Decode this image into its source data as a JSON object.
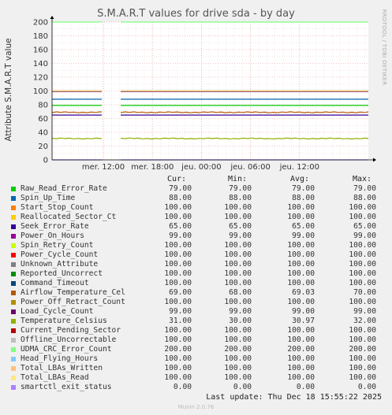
{
  "chart_data": {
    "type": "line",
    "title": "S.M.A.R.T values for drive sda - by day",
    "ylabel": "Attribute S.M.A.R.T value",
    "ylim": [
      0,
      200
    ],
    "yticks": [
      0,
      20,
      40,
      60,
      80,
      100,
      120,
      140,
      160,
      180,
      200
    ],
    "xticks": [
      "mer. 12:00",
      "mer. 18:00",
      "jeu. 00:00",
      "jeu. 06:00",
      "jeu. 12:00"
    ],
    "gap": "short gap in data shortly before mer. 12:00",
    "columns": [
      "Cur:",
      "Min:",
      "Avg:",
      "Max:"
    ],
    "series": [
      {
        "name": "Raw_Read_Error_Rate",
        "color": "#00cc00",
        "cur": "79.00",
        "min": "79.00",
        "avg": "79.00",
        "max": "79.00",
        "value": 79
      },
      {
        "name": "Spin_Up_Time",
        "color": "#0066b3",
        "cur": "88.00",
        "min": "88.00",
        "avg": "88.00",
        "max": "88.00",
        "value": 88
      },
      {
        "name": "Start_Stop_Count",
        "color": "#ff8000",
        "cur": "100.00",
        "min": "100.00",
        "avg": "100.00",
        "max": "100.00",
        "value": 100
      },
      {
        "name": "Reallocated_Sector_Ct",
        "color": "#ffcc00",
        "cur": "100.00",
        "min": "100.00",
        "avg": "100.00",
        "max": "100.00",
        "value": 100
      },
      {
        "name": "Seek_Error_Rate",
        "color": "#330099",
        "cur": "65.00",
        "min": "65.00",
        "avg": "65.00",
        "max": "65.00",
        "value": 65
      },
      {
        "name": "Power_On_Hours",
        "color": "#990099",
        "cur": "99.00",
        "min": "99.00",
        "avg": "99.00",
        "max": "99.00",
        "value": 99
      },
      {
        "name": "Spin_Retry_Count",
        "color": "#ccff00",
        "cur": "100.00",
        "min": "100.00",
        "avg": "100.00",
        "max": "100.00",
        "value": 100
      },
      {
        "name": "Power_Cycle_Count",
        "color": "#ff0000",
        "cur": "100.00",
        "min": "100.00",
        "avg": "100.00",
        "max": "100.00",
        "value": 100
      },
      {
        "name": "Unknown_Attribute",
        "color": "#808080",
        "cur": "100.00",
        "min": "100.00",
        "avg": "100.00",
        "max": "100.00",
        "value": 100
      },
      {
        "name": "Reported_Uncorrect",
        "color": "#008f00",
        "cur": "100.00",
        "min": "100.00",
        "avg": "100.00",
        "max": "100.00",
        "value": 100
      },
      {
        "name": "Command_Timeout",
        "color": "#00487d",
        "cur": "100.00",
        "min": "100.00",
        "avg": "100.00",
        "max": "100.00",
        "value": 100
      },
      {
        "name": "Airflow_Temperature_Cel",
        "color": "#b35a00",
        "cur": "69.00",
        "min": "68.00",
        "avg": "69.03",
        "max": "70.00",
        "value": 69,
        "wobble": true
      },
      {
        "name": "Power_Off_Retract_Count",
        "color": "#b38f00",
        "cur": "100.00",
        "min": "100.00",
        "avg": "100.00",
        "max": "100.00",
        "value": 100
      },
      {
        "name": "Load_Cycle_Count",
        "color": "#6b006b",
        "cur": "99.00",
        "min": "99.00",
        "avg": "99.00",
        "max": "99.00",
        "value": 99
      },
      {
        "name": "Temperature_Celsius",
        "color": "#8fb300",
        "cur": "31.00",
        "min": "30.00",
        "avg": "30.97",
        "max": "32.00",
        "value": 31,
        "wobble": true
      },
      {
        "name": "Current_Pending_Sector",
        "color": "#b30000",
        "cur": "100.00",
        "min": "100.00",
        "avg": "100.00",
        "max": "100.00",
        "value": 100
      },
      {
        "name": "Offline_Uncorrectable",
        "color": "#bebebe",
        "cur": "100.00",
        "min": "100.00",
        "avg": "100.00",
        "max": "100.00",
        "value": 100
      },
      {
        "name": "UDMA_CRC_Error_Count",
        "color": "#80ff80",
        "cur": "200.00",
        "min": "200.00",
        "avg": "200.00",
        "max": "200.00",
        "value": 200
      },
      {
        "name": "Head_Flying_Hours",
        "color": "#80c9ff",
        "cur": "100.00",
        "min": "100.00",
        "avg": "100.00",
        "max": "100.00",
        "value": 100
      },
      {
        "name": "Total_LBAs_Written",
        "color": "#ffc080",
        "cur": "100.00",
        "min": "100.00",
        "avg": "100.00",
        "max": "100.00",
        "value": 100
      },
      {
        "name": "Total_LBAs_Read",
        "color": "#ffe680",
        "cur": "100.00",
        "min": "100.00",
        "avg": "100.00",
        "max": "100.00",
        "value": 100
      },
      {
        "name": "smartctl_exit_status",
        "color": "#aa80ff",
        "cur": "0.00",
        "min": "0.00",
        "avg": "0.00",
        "max": "0.00",
        "value": 0
      }
    ]
  },
  "last_update": "Last update: Thu Dec 18 15:55:22 2025",
  "watermark": "RRDTOOL / TOBI OETIKER",
  "version": "Munin 2.0.76"
}
